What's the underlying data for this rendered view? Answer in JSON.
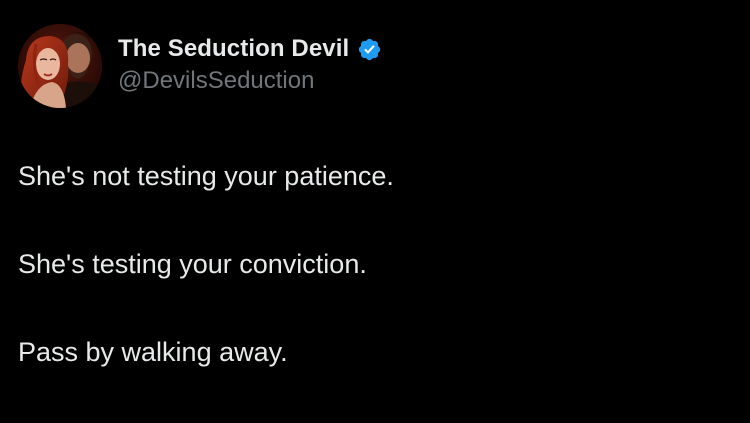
{
  "tweet": {
    "author": {
      "display_name": "The Seduction Devil",
      "handle": "@DevilsSeduction",
      "verified": true,
      "avatar": "couple-portrait-avatar"
    },
    "text_lines": [
      "She's not testing your patience.",
      "She's testing your conviction.",
      "Pass by walking away."
    ]
  },
  "colors": {
    "background": "#000000",
    "primary_text": "#e7e9ea",
    "secondary_text": "#71767b",
    "verified_badge": "#1d9bf0"
  },
  "icons": {
    "verified": "verified-badge-icon"
  }
}
